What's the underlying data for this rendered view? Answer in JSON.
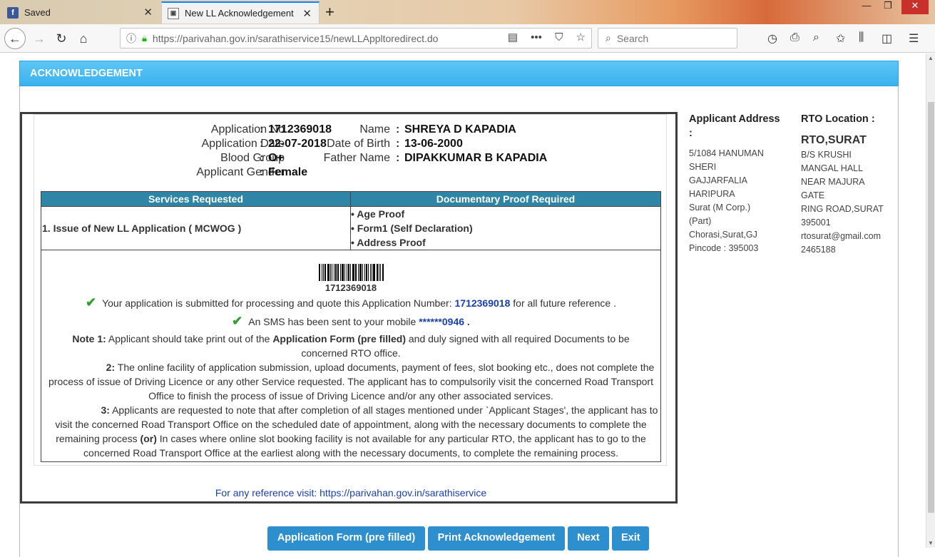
{
  "browser": {
    "tabs": [
      {
        "label": "Saved"
      },
      {
        "label": "New LL Acknowledgement"
      }
    ],
    "url_host": "https://parivahan.gov.in",
    "url_path": "/sarathiservice15/newLLAppltoredirect.do",
    "search_placeholder": "Search"
  },
  "panel": {
    "title": "ACKNOWLEDGEMENT"
  },
  "applicant": {
    "app_no_label": "Application No",
    "app_no": "1712369018",
    "app_date_label": "Application Date",
    "app_date": "22-07-2018",
    "blood_label": "Blood Group",
    "blood": "O+",
    "gender_label": "Applicant Gender",
    "gender": "Female",
    "name_label": "Name",
    "name": "SHREYA D KAPADIA",
    "dob_label": "Date of Birth",
    "dob": "13-06-2000",
    "father_label": "Father Name",
    "father": "DIPAKKUMAR B KAPADIA"
  },
  "services": {
    "col1": "Services Requested",
    "col2": "Documentary Proof Required",
    "service": "1. Issue of New LL Application ( MCWOG )",
    "proofs": [
      "• Age Proof",
      "• Form1 (Self Declaration)",
      "• Address Proof"
    ]
  },
  "messages": {
    "barcode_number": "1712369018",
    "submitted_pre": "Your application is submitted for processing and quote this Application Number: ",
    "submitted_num": "1712369018",
    "submitted_post": " for all future reference .",
    "sms_pre": "An SMS has been sent to your mobile ",
    "sms_num": "******0946",
    "sms_post": " .",
    "note1_label": "Note 1:",
    "note1_a": " Applicant should take print out of the ",
    "note1_b": "Application Form (pre filled)",
    "note1_c": " and duly signed with all required Documents to be concerned RTO office.",
    "note2_label": "2:",
    "note2_text": " The online facility of application submission, upload documents, payment of fees, slot booking etc., does not complete the process of issue of Driving Licence or any other Service requested. The applicant has to compulsorily visit the concerned Road Transport Office to finish the process of issue of Driving Licence and/or any other associated services.",
    "note3_label": "3:",
    "note3_a": " Applicants are requested to note that after completion of all stages mentioned under `Applicant Stages', the applicant has to visit the concerned Road Transport Office on the scheduled date of appointment, along with the necessary documents to complete the remaining process ",
    "note3_or": "(or)",
    "note3_b": " In cases where online slot booking facility is not available for any particular RTO, the applicant has to go to the concerned Road Transport Office at the earliest along with the necessary documents, to complete the remaining process.",
    "reference": "For any reference visit: https://parivahan.gov.in/sarathiservice"
  },
  "address": {
    "title": "Applicant Address :",
    "lines": [
      "5/1084 HANUMAN",
      "SHERI",
      "GAJJARFALIA",
      "HARIPURA",
      "Surat (M Corp.)",
      "(Part)",
      "Chorasi,Surat,GJ",
      "Pincode : 395003"
    ]
  },
  "rto": {
    "title": "RTO Location :",
    "name": "RTO,SURAT",
    "lines": [
      "B/S KRUSHI",
      "MANGAL HALL",
      "NEAR MAJURA",
      "GATE",
      "RING ROAD,SURAT",
      "395001",
      "rtosurat@gmail.com",
      "2465188"
    ]
  },
  "buttons": {
    "app_form": "Application Form (pre filled)",
    "print_ack": "Print Acknowledgement",
    "next": "Next",
    "exit": "Exit"
  }
}
